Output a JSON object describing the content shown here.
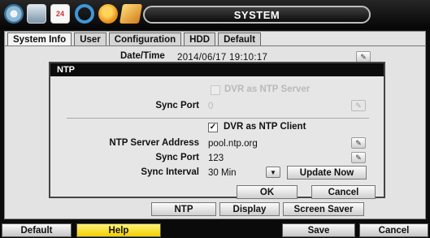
{
  "header": {
    "title": "SYSTEM",
    "icons": [
      "gear-icon",
      "tv-icon",
      "calendar-icon",
      "ring-icon",
      "disk-icon",
      "wand-icon"
    ],
    "calendar_text": "24"
  },
  "tabs": [
    {
      "label": "System Info",
      "active": true
    },
    {
      "label": "User"
    },
    {
      "label": "Configuration"
    },
    {
      "label": "HDD"
    },
    {
      "label": "Default"
    }
  ],
  "datetime": {
    "label": "Date/Time",
    "value": "2014/06/17 19:10:17"
  },
  "sub_buttons": [
    "NTP",
    "Display",
    "Screen Saver"
  ],
  "dialog": {
    "title": "NTP",
    "server_mode_label": "DVR as NTP Server",
    "server_sync_port_label": "Sync Port",
    "server_sync_port_value": "0",
    "client_mode_label": "DVR as NTP Client",
    "client_checked": true,
    "server_address_label": "NTP Server Address",
    "server_address_value": "pool.ntp.org",
    "client_sync_port_label": "Sync Port",
    "client_sync_port_value": "123",
    "sync_interval_label": "Sync Interval",
    "sync_interval_value": "30 Min",
    "update_now_label": "Update Now",
    "ok_label": "OK",
    "cancel_label": "Cancel"
  },
  "bottom": {
    "default_label": "Default",
    "help_label": "Help",
    "save_label": "Save",
    "cancel_label": "Cancel"
  },
  "colors": {
    "help_button": "#f2cf00",
    "dialog_title_bg": "#0b0b0b",
    "top_bar": "#050505"
  }
}
